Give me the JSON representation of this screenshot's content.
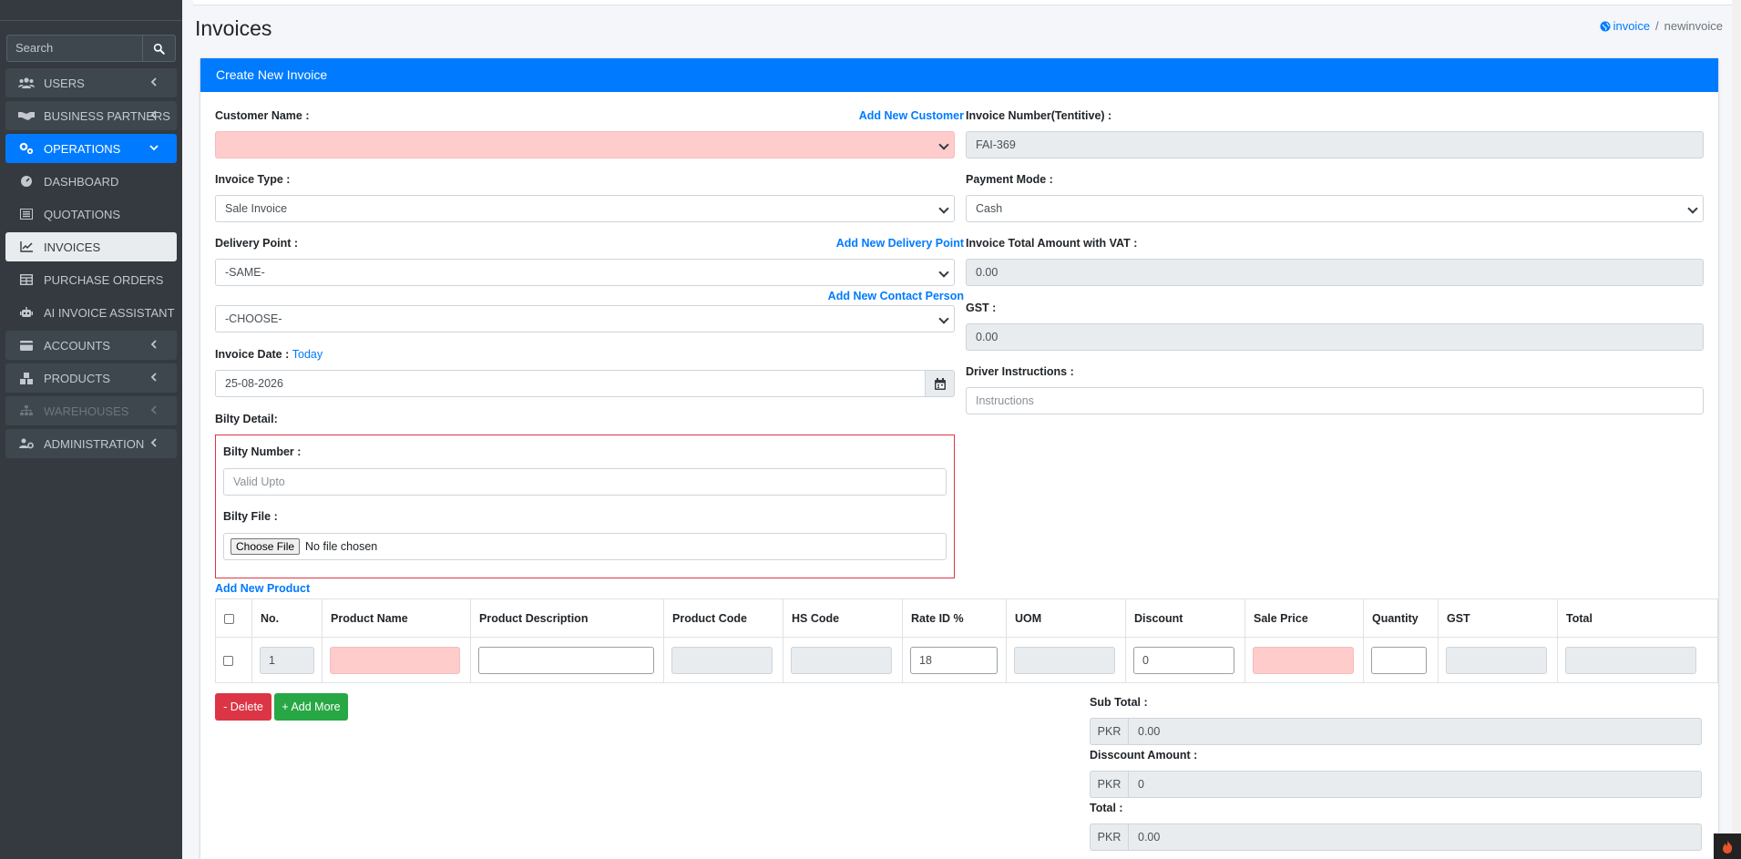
{
  "sidebar": {
    "search_placeholder": "Search",
    "items": [
      {
        "label": "USERS",
        "icon": "users-icon"
      },
      {
        "label": "BUSINESS PARTNERS",
        "icon": "handshake-icon"
      },
      {
        "label": "OPERATIONS",
        "icon": "gears-icon"
      },
      {
        "label": "DASHBOARD",
        "icon": "tachometer-icon"
      },
      {
        "label": "QUOTATIONS",
        "icon": "list-icon"
      },
      {
        "label": "INVOICES",
        "icon": "chart-line-icon"
      },
      {
        "label": "PURCHASE ORDERS",
        "icon": "table-icon"
      },
      {
        "label": "AI INVOICE ASSISTANT",
        "icon": "robot-icon"
      },
      {
        "label": "ACCOUNTS",
        "icon": "credit-card-icon"
      },
      {
        "label": "PRODUCTS",
        "icon": "cubes-icon"
      },
      {
        "label": "WAREHOUSES",
        "icon": "sitemap-icon"
      },
      {
        "label": "ADMINISTRATION",
        "icon": "users-cog-icon"
      }
    ]
  },
  "page": {
    "title": "Invoices",
    "breadcrumb": {
      "link": "invoice",
      "separator": "/",
      "current": "newinvoice"
    }
  },
  "form": {
    "card_title": "Create New Invoice",
    "customer_name_label": "Customer Name :",
    "add_customer": "Add New Customer",
    "invoice_number_label": "Invoice Number(Tentitive) :",
    "invoice_number_value": "FAI-369",
    "invoice_type_label": "Invoice Type :",
    "invoice_type_value": "Sale Invoice",
    "payment_mode_label": "Payment Mode :",
    "payment_mode_value": "Cash",
    "delivery_point_label": "Delivery Point :",
    "add_delivery_point": "Add New Delivery Point",
    "delivery_point_value": "-SAME-",
    "total_vat_label": "Invoice Total Amount with VAT :",
    "total_vat_value": "0.00",
    "add_contact_person": "Add New Contact Person",
    "contact_value": "-CHOOSE-",
    "gst_label": "GST :",
    "gst_value": "0.00",
    "invoice_date_label": "Invoice Date :",
    "today_link": "Today",
    "invoice_date_value": "25-08-2026",
    "driver_label": "Driver Instructions :",
    "driver_placeholder": "Instructions",
    "bilty_detail_label": "Bilty Detail:",
    "bilty_number_label": "Bilty Number :",
    "bilty_number_placeholder": "Valid Upto",
    "bilty_file_label": "Bilty File :",
    "choose_file": "Choose File",
    "no_file": "No file chosen",
    "add_product": "Add New Product"
  },
  "table": {
    "headers": [
      "No.",
      "Product Name",
      "Product Description",
      "Product Code",
      "HS Code",
      "Rate ID %",
      "UOM",
      "Discount",
      "Sale Price",
      "Quantity",
      "GST",
      "Total"
    ],
    "row": {
      "no": "1",
      "rate": "18",
      "discount": "0"
    }
  },
  "actions": {
    "delete": "- Delete",
    "add_more": "+ Add More"
  },
  "totals": {
    "subtotal_label": "Sub Total :",
    "subtotal_value": "0.00",
    "discount_label": "Disscount Amount :",
    "discount_value": "0",
    "total_label": "Total :",
    "total_value": "0.00",
    "currency": "PKR"
  },
  "colors": {
    "primary": "#007bff",
    "danger": "#dc3545",
    "success": "#28a745",
    "sidebar": "#343a40"
  }
}
